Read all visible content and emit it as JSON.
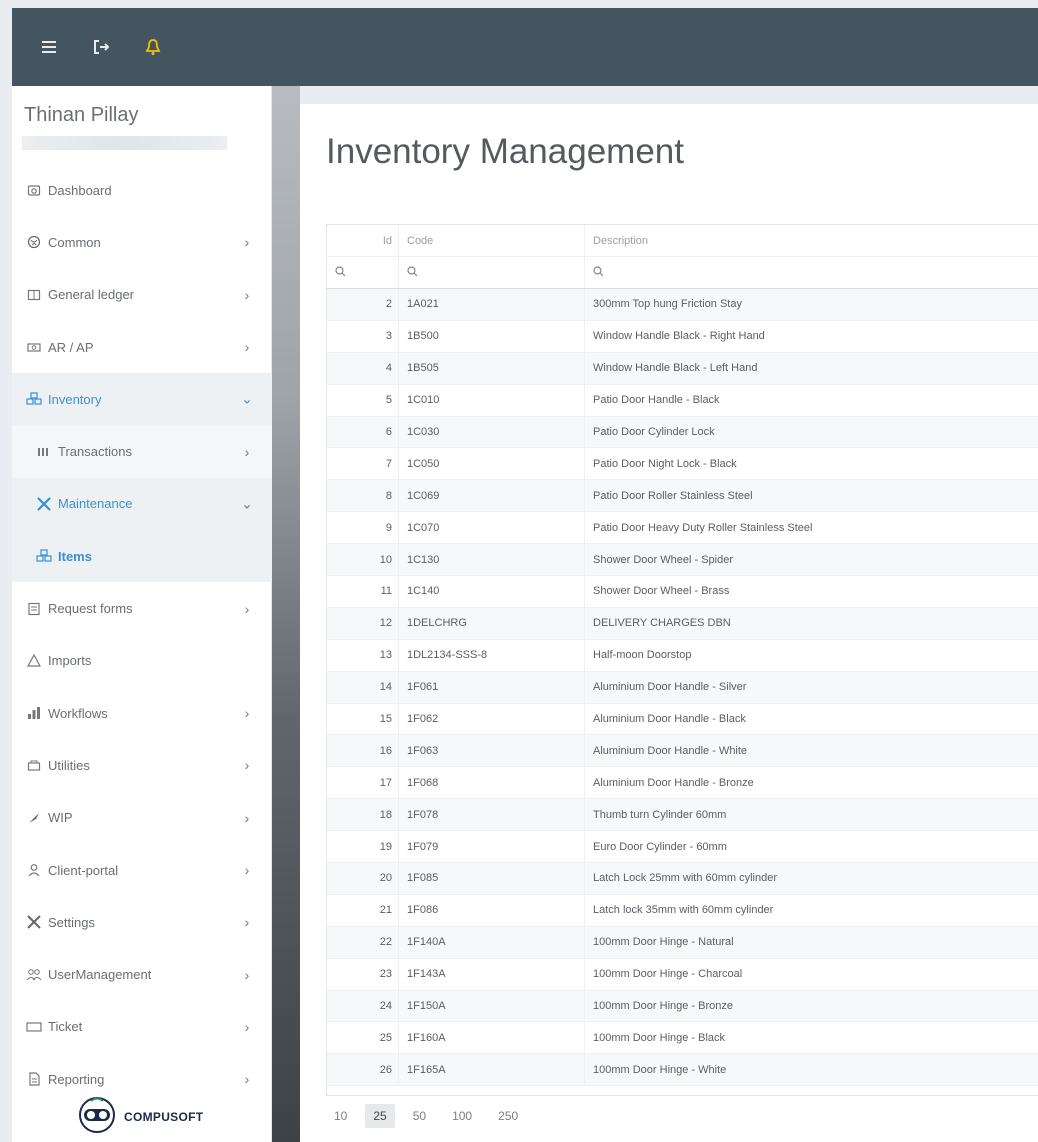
{
  "topbar": {
    "icons": [
      "menu-icon",
      "logout-icon",
      "bell-icon"
    ],
    "bell_color": "#f2c200"
  },
  "user": {
    "name": "Thinan Pillay"
  },
  "sidebar": {
    "items": [
      {
        "label": "Dashboard",
        "icon": "dashboard-icon",
        "chevron": ""
      },
      {
        "label": "Common",
        "icon": "globe-icon",
        "chevron": "›"
      },
      {
        "label": "General ledger",
        "icon": "book-icon",
        "chevron": "›"
      },
      {
        "label": "AR / AP",
        "icon": "money-icon",
        "chevron": "›"
      },
      {
        "label": "Inventory",
        "icon": "boxes-icon",
        "chevron": "⌄"
      },
      {
        "label": "Transactions",
        "icon": "transactions-icon",
        "chevron": "›"
      },
      {
        "label": "Maintenance",
        "icon": "tools-icon",
        "chevron": "⌄"
      },
      {
        "label": "Items",
        "icon": "boxes-icon",
        "chevron": ""
      },
      {
        "label": "Request forms",
        "icon": "form-icon",
        "chevron": "›"
      },
      {
        "label": "Imports",
        "icon": "import-icon",
        "chevron": ""
      },
      {
        "label": "Workflows",
        "icon": "workflow-icon",
        "chevron": "›"
      },
      {
        "label": "Utilities",
        "icon": "utilities-icon",
        "chevron": "›"
      },
      {
        "label": "WIP",
        "icon": "wip-icon",
        "chevron": "›"
      },
      {
        "label": "Client-portal",
        "icon": "user-icon",
        "chevron": "›"
      },
      {
        "label": "Settings",
        "icon": "settings-icon",
        "chevron": "›"
      },
      {
        "label": "UserManagement",
        "icon": "users-icon",
        "chevron": "›"
      },
      {
        "label": "Ticket",
        "icon": "ticket-icon",
        "chevron": "›"
      },
      {
        "label": "Reporting",
        "icon": "report-icon",
        "chevron": "›"
      }
    ]
  },
  "brand": {
    "name": "COMPUSOFT",
    "color": "#1b2a4a"
  },
  "page": {
    "title": "Inventory Management"
  },
  "grid": {
    "columns": {
      "id": "Id",
      "code": "Code",
      "description": "Description"
    },
    "rows": [
      {
        "id": "2",
        "code": "1A021",
        "description": "300mm Top hung Friction Stay"
      },
      {
        "id": "3",
        "code": "1B500",
        "description": "Window Handle Black - Right Hand"
      },
      {
        "id": "4",
        "code": "1B505",
        "description": "Window Handle Black - Left Hand"
      },
      {
        "id": "5",
        "code": "1C010",
        "description": "Patio Door Handle - Black"
      },
      {
        "id": "6",
        "code": "1C030",
        "description": "Patio Door Cylinder Lock"
      },
      {
        "id": "7",
        "code": "1C050",
        "description": "Patio Door Night Lock - Black"
      },
      {
        "id": "8",
        "code": "1C069",
        "description": "Patio Door Roller Stainless Steel"
      },
      {
        "id": "9",
        "code": "1C070",
        "description": "Patio Door Heavy Duty Roller Stainless Steel"
      },
      {
        "id": "10",
        "code": "1C130",
        "description": "Shower Door Wheel - Spider"
      },
      {
        "id": "11",
        "code": "1C140",
        "description": "Shower Door Wheel - Brass"
      },
      {
        "id": "12",
        "code": "1DELCHRG",
        "description": "DELIVERY CHARGES DBN"
      },
      {
        "id": "13",
        "code": "1DL2134-SSS-8",
        "description": "Half-moon Doorstop"
      },
      {
        "id": "14",
        "code": "1F061",
        "description": "Aluminium Door Handle - Silver"
      },
      {
        "id": "15",
        "code": "1F062",
        "description": "Aluminium Door Handle - Black"
      },
      {
        "id": "16",
        "code": "1F063",
        "description": "Aluminium Door Handle - White"
      },
      {
        "id": "17",
        "code": "1F068",
        "description": "Aluminium Door Handle - Bronze"
      },
      {
        "id": "18",
        "code": "1F078",
        "description": "Thumb turn Cylinder 60mm"
      },
      {
        "id": "19",
        "code": "1F079",
        "description": "Euro Door Cylinder - 60mm"
      },
      {
        "id": "20",
        "code": "1F085",
        "description": "Latch Lock 25mm with 60mm cylinder"
      },
      {
        "id": "21",
        "code": "1F086",
        "description": "Latch lock 35mm with 60mm cylinder"
      },
      {
        "id": "22",
        "code": "1F140A",
        "description": "100mm Door Hinge - Natural"
      },
      {
        "id": "23",
        "code": "1F143A",
        "description": "100mm Door Hinge - Charcoal"
      },
      {
        "id": "24",
        "code": "1F150A",
        "description": "100mm Door Hinge - Bronze"
      },
      {
        "id": "25",
        "code": "1F160A",
        "description": "100mm Door Hinge - Black"
      },
      {
        "id": "26",
        "code": "1F165A",
        "description": "100mm Door Hinge - White"
      }
    ]
  },
  "pager": {
    "sizes": [
      "10",
      "25",
      "50",
      "100",
      "250"
    ],
    "selected": "25"
  },
  "colors": {
    "topbar": "#455560",
    "active": "#3a8fd6"
  }
}
